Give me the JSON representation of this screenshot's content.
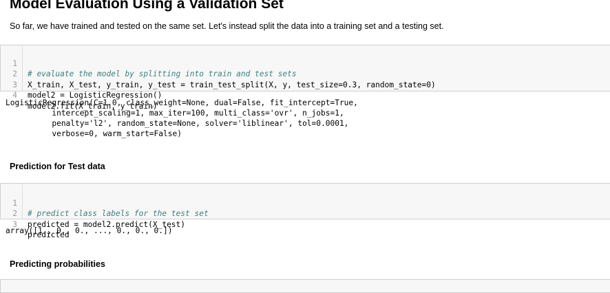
{
  "section1": {
    "title": "Model Evaluation Using a Validation Set",
    "intro": "So far, we have trained and tested on the same set. Let's instead split the data into a training set and a testing set."
  },
  "cell1": {
    "line_numbers": [
      "1",
      "2",
      "3",
      "4"
    ],
    "lines": [
      "# evaluate the model by splitting into train and test sets",
      "X_train, X_test, y_train, y_test = train_test_split(X, y, test_size=0.3, random_state=0)",
      "model2 = LogisticRegression()",
      "model2.fit(X_train, y_train)"
    ]
  },
  "output1": {
    "text": "LogisticRegression(C=1.0, class_weight=None, dual=False, fit_intercept=True,\n          intercept_scaling=1, max_iter=100, multi_class='ovr', n_jobs=1,\n          penalty='l2', random_state=None, solver='liblinear', tol=0.0001,\n          verbose=0, warm_start=False)"
  },
  "section2": {
    "title": "Prediction for Test data"
  },
  "cell2": {
    "line_numbers": [
      "1",
      "2",
      "3"
    ],
    "lines": [
      "# predict class labels for the test set",
      "predicted = model2.predict(X_test)",
      "predicted"
    ]
  },
  "output2": {
    "text": "array([1., 0., 0., ..., 0., 0., 0.])"
  },
  "section3": {
    "title": "Predicting probabilities"
  }
}
